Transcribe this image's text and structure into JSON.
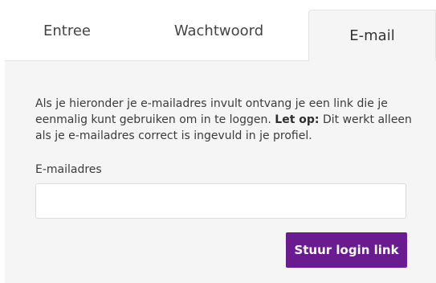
{
  "tabs": {
    "entree": "Entree",
    "wachtwoord": "Wachtwoord",
    "email": "E-mail",
    "active": "email"
  },
  "form": {
    "description_part1": "Als je hieronder je e-mailadres invult ontvang je een link die je eenmalig kunt gebruiken om in te loggen.",
    "description_strong": "Let op:",
    "description_part2": "Dit werkt alleen als je e-mailadres correct is ingevuld in je profiel.",
    "email_label": "E-mailadres",
    "email_value": "",
    "submit_label": "Stuur login link"
  },
  "colors": {
    "accent": "#6a1b8f",
    "panel_background": "#f5f5f5",
    "text": "#333333"
  }
}
